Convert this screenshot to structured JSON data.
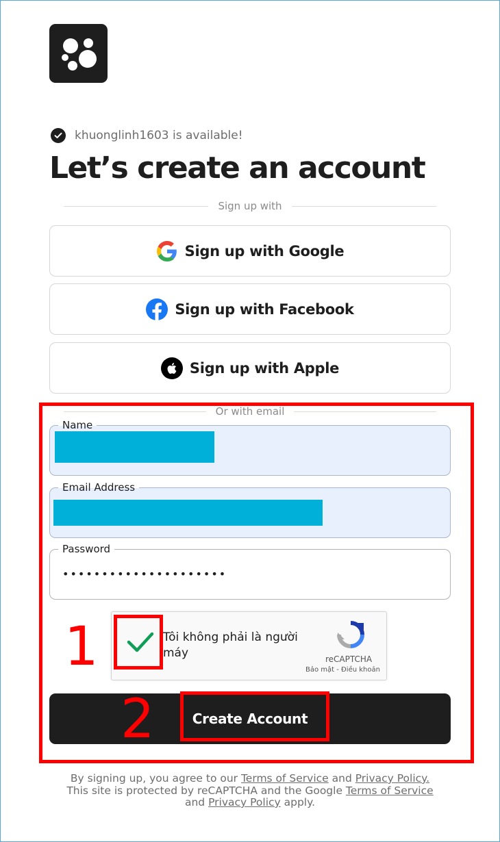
{
  "availability": {
    "text": "khuonglinh1603 is available!"
  },
  "heading": "Let’s create an account",
  "divider_signup": "Sign up with",
  "social": [
    {
      "icon": "google-icon",
      "label": "Sign up with Google"
    },
    {
      "icon": "facebook-icon",
      "label": "Sign up with Facebook"
    },
    {
      "icon": "apple-icon",
      "label": "Sign up with Apple"
    }
  ],
  "divider_email": "Or with email",
  "form": {
    "name_label": "Name",
    "email_label": "Email Address",
    "password_label": "Password",
    "password_value": "•••••••••••••••••••••"
  },
  "captcha": {
    "text": "Tôi không phải là người máy",
    "brand": "reCAPTCHA",
    "privacy": "Bảo mật",
    "sep": " - ",
    "terms": "Điều khoản",
    "checked": true
  },
  "submit_label": "Create Account",
  "annotations": {
    "one": "1",
    "two": "2"
  },
  "legal": {
    "l1_a": "By signing up, you agree to our ",
    "l1_link1": "Terms of Service",
    "l1_b": " and ",
    "l1_link2": "Privacy Policy.",
    "l2_a": "This site is protected by reCAPTCHA and the Google ",
    "l2_link": "Terms of Service",
    "l3_a": "and ",
    "l3_link": "Privacy Policy",
    "l3_b": " apply."
  },
  "colors": {
    "primary": "#1e1e1e",
    "annotation_red": "#ff0000",
    "redaction": "#00b0d8",
    "autofill_bg": "#e8f0fe",
    "captcha_check": "#109d58"
  }
}
